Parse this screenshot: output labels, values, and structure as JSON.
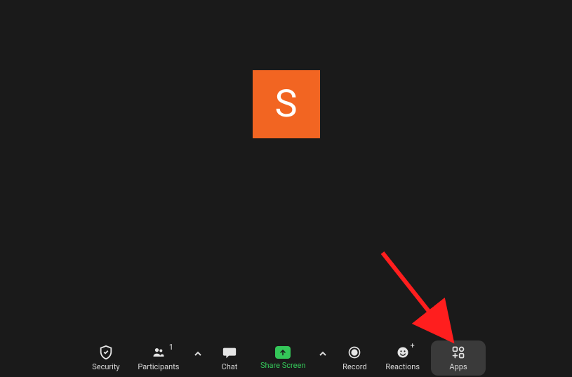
{
  "avatar": {
    "initial": "S",
    "bg": "#f26522"
  },
  "toolbar": {
    "security_label": "Security",
    "participants_label": "Participants",
    "participants_count": "1",
    "chat_label": "Chat",
    "share_label": "Share Screen",
    "record_label": "Record",
    "reactions_label": "Reactions",
    "apps_label": "Apps"
  },
  "annotation": {
    "arrow_color": "#ff1e1e"
  }
}
